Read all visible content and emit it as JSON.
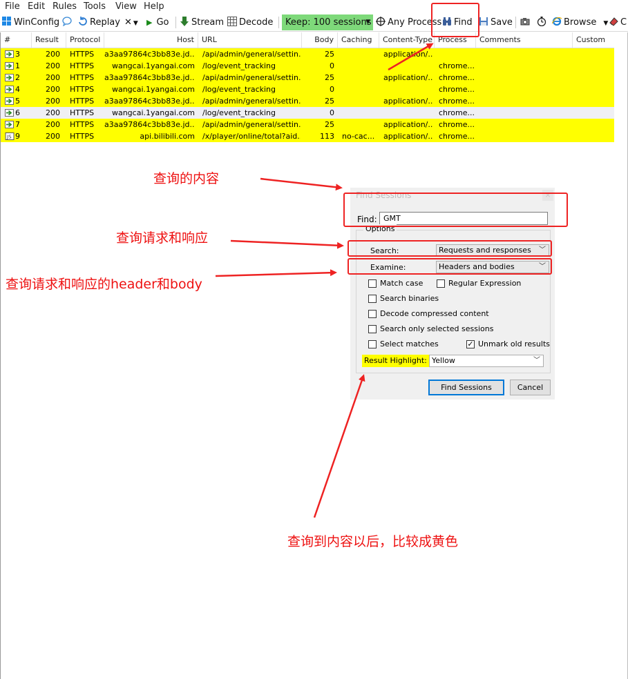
{
  "menu": [
    "File",
    "Edit",
    "Rules",
    "Tools",
    "View",
    "Help"
  ],
  "toolbar": {
    "winconfig": "WinConfig",
    "replay": "Replay",
    "remove": "✕",
    "go": "Go",
    "stream": "Stream",
    "decode": "Decode",
    "keep": "Keep: 100 sessions",
    "any_process": "Any Process",
    "find": "Find",
    "save": "Save",
    "browse": "Browse",
    "clear": "C"
  },
  "grid": {
    "columns": [
      "#",
      "Result",
      "Protocol",
      "Host",
      "URL",
      "Body",
      "Caching",
      "Content-Type",
      "Process",
      "Comments",
      "Custom"
    ],
    "rows": [
      {
        "id": "3",
        "result": "200",
        "protocol": "HTTPS",
        "host": "a3aa97864c3bb83e.jd...",
        "url": "/api/admin/general/settin...",
        "body": "25",
        "caching": "",
        "content_type": "application/...",
        "process": "",
        "highlight": "yellow",
        "icon": "arrow"
      },
      {
        "id": "1",
        "result": "200",
        "protocol": "HTTPS",
        "host": "wangcai.1yangai.com",
        "url": "/log/event_tracking",
        "body": "0",
        "caching": "",
        "content_type": "",
        "process": "chrome...",
        "highlight": "yellow",
        "icon": "arrow"
      },
      {
        "id": "2",
        "result": "200",
        "protocol": "HTTPS",
        "host": "a3aa97864c3bb83e.jd...",
        "url": "/api/admin/general/settin...",
        "body": "25",
        "caching": "",
        "content_type": "application/...",
        "process": "chrome...",
        "highlight": "yellow",
        "icon": "arrow"
      },
      {
        "id": "4",
        "result": "200",
        "protocol": "HTTPS",
        "host": "wangcai.1yangai.com",
        "url": "/log/event_tracking",
        "body": "0",
        "caching": "",
        "content_type": "",
        "process": "chrome...",
        "highlight": "yellow",
        "icon": "arrow"
      },
      {
        "id": "5",
        "result": "200",
        "protocol": "HTTPS",
        "host": "a3aa97864c3bb83e.jd...",
        "url": "/api/admin/general/settin...",
        "body": "25",
        "caching": "",
        "content_type": "application/...",
        "process": "chrome...",
        "highlight": "yellow",
        "icon": "arrow"
      },
      {
        "id": "6",
        "result": "200",
        "protocol": "HTTPS",
        "host": "wangcai.1yangai.com",
        "url": "/log/event_tracking",
        "body": "0",
        "caching": "",
        "content_type": "",
        "process": "chrome...",
        "highlight": "none",
        "icon": "arrow"
      },
      {
        "id": "7",
        "result": "200",
        "protocol": "HTTPS",
        "host": "a3aa97864c3bb83e.jd...",
        "url": "/api/admin/general/settin...",
        "body": "25",
        "caching": "",
        "content_type": "application/...",
        "process": "chrome...",
        "highlight": "yellow",
        "icon": "arrow"
      },
      {
        "id": "9",
        "result": "200",
        "protocol": "HTTPS",
        "host": "api.bilibili.com",
        "url": "/x/player/online/total?aid...",
        "body": "113",
        "caching": "no-cac...",
        "content_type": "application/...",
        "process": "chrome...",
        "highlight": "yellow",
        "icon": "js"
      }
    ]
  },
  "dialog": {
    "title": "Find Sessions",
    "close": "×",
    "find_label": "Find:",
    "find_value": "GMT",
    "options_legend": "Options",
    "search_label": "Search:",
    "search_value": "Requests and responses",
    "examine_label": "Examine:",
    "examine_value": "Headers and bodies",
    "match_case": "Match case",
    "regex": "Regular Expression",
    "search_binaries": "Search binaries",
    "decode_compressed": "Decode compressed content",
    "only_selected": "Search only selected sessions",
    "select_matches": "Select matches",
    "unmark_old": "Unmark old results",
    "unmark_checked": true,
    "result_highlight_label": "Result Highlight:",
    "result_highlight_value": "Yellow",
    "find_button": "Find Sessions",
    "cancel_button": "Cancel"
  },
  "annotations": {
    "find_content": "查询的内容",
    "search_req_resp": "查询请求和响应",
    "examine_header_body": "查询请求和响应的header和body",
    "result_yellow": "查询到内容以后，比较成黄色"
  },
  "colors": {
    "highlight": "#ffff00",
    "keep_bg": "#7ed97a",
    "annotation": "#ee2222",
    "focus_border": "#0078d7"
  }
}
